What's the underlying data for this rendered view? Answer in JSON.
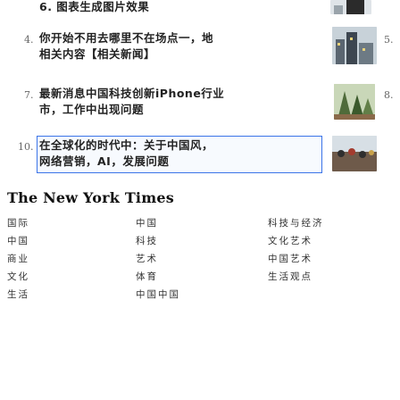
{
  "news": {
    "items": [
      {
        "number": "",
        "title_lines": [
          "6. 图表生成图片效果"
        ],
        "thumb": "person-dark-icon"
      },
      {
        "number": "4.",
        "title_lines": [
          "你开始不用去哪里不在场点一，地",
          "相关内容【相关新闻】"
        ],
        "thumb": "city-buildings-icon",
        "side_number": "5."
      },
      {
        "number": "7.",
        "title_lines": [
          "最新消息中国科技创新iPhone行业",
          "市，工作中出现问题"
        ],
        "thumb": "forest-scene-icon",
        "side_number": "8."
      },
      {
        "number": "10.",
        "title_lines": [
          "在全球化的时代中：关于中国风，",
          "网络营销，AI，发展问题"
        ],
        "thumb": "crowd-parade-icon",
        "highlighted": true
      }
    ]
  },
  "masthead": {
    "title": "The New York Times"
  },
  "sections": {
    "columns": [
      [
        "国际",
        "中国",
        "商业",
        "文化",
        "生活"
      ],
      [
        "中国",
        "科技",
        "艺术",
        "体育",
        "中国中国"
      ],
      [
        "科技与经济",
        "文化艺术",
        "中国艺术",
        "生活观点"
      ]
    ]
  },
  "colors": {
    "accent": "#3a73e8",
    "text": "#222222"
  }
}
